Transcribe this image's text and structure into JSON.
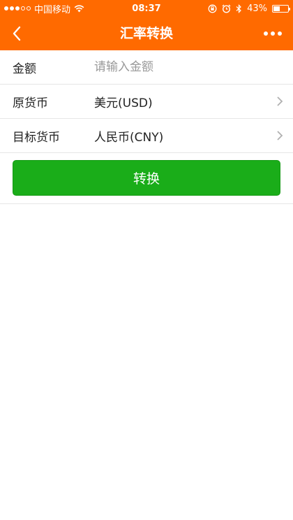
{
  "status_bar": {
    "carrier": "中国移动",
    "time": "08:37",
    "battery": "43%",
    "battery_level": 0.43,
    "icons": [
      "signal-dots-icon",
      "wifi-icon",
      "rotation-lock-icon",
      "alarm-icon",
      "bluetooth-icon",
      "battery-icon"
    ]
  },
  "nav": {
    "title": "汇率转换",
    "back_icon": "chevron-left-icon",
    "more_icon": "more-dots-icon"
  },
  "form": {
    "amount": {
      "label": "金额",
      "placeholder": "请输入金额",
      "value": ""
    },
    "source_currency": {
      "label": "原货币",
      "value": "美元(USD)"
    },
    "target_currency": {
      "label": "目标货币",
      "value": "人民币(CNY)"
    }
  },
  "actions": {
    "convert_label": "转换"
  },
  "colors": {
    "brand": "#ff6a00",
    "primary_button": "#1aad19",
    "divider": "#e6e6e6",
    "placeholder": "#999999"
  }
}
